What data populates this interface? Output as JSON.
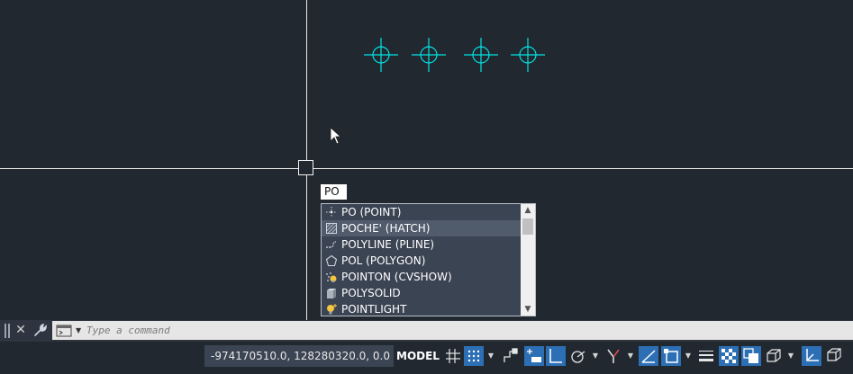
{
  "autocomplete": {
    "typed_text": "PO",
    "items": [
      {
        "label": "PO (POINT)",
        "icon": "point-icon",
        "selected": false
      },
      {
        "label": "POCHE' (HATCH)",
        "icon": "hatch-icon",
        "selected": true
      },
      {
        "label": "POLYLINE (PLINE)",
        "icon": "polyline-icon",
        "selected": false
      },
      {
        "label": "POL (POLYGON)",
        "icon": "polygon-icon",
        "selected": false
      },
      {
        "label": "POINTON (CVSHOW)",
        "icon": "pointcloud-icon",
        "selected": false
      },
      {
        "label": "POLYSOLID",
        "icon": "polysolid-icon",
        "selected": false
      },
      {
        "label": "POINTLIGHT",
        "icon": "light-bulb-icon",
        "selected": false
      }
    ]
  },
  "command_line": {
    "placeholder": "Type a command"
  },
  "status_bar": {
    "coordinates": "-974170510.0, 128280320.0, 0.0",
    "model_label": "MODEL"
  },
  "colors": {
    "canvas_bg": "#212830",
    "point_marker": "#00e5e5",
    "crosshair": "#e8e8e8",
    "toggle_on": "#2d6fb5"
  }
}
